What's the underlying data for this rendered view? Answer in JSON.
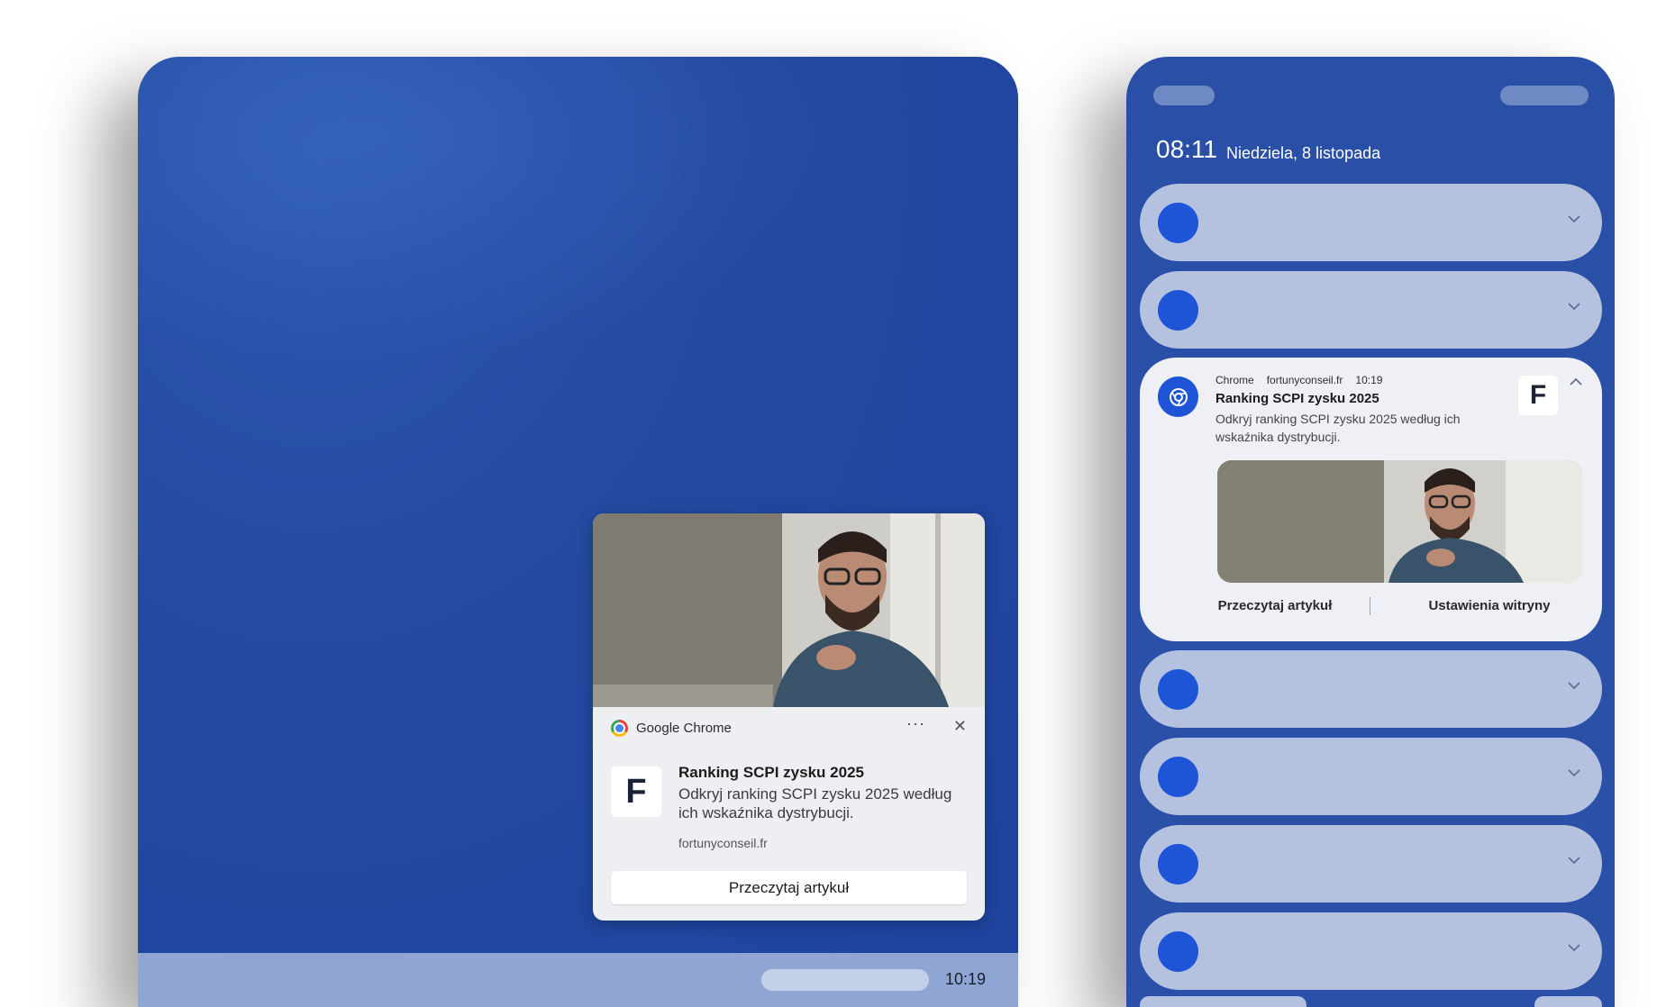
{
  "desktop": {
    "taskbar": {
      "time": "10:19"
    },
    "toast": {
      "app_name": "Google Chrome",
      "more_icon": "more-horizontal-icon",
      "close_icon": "close-icon",
      "logo_letter": "F",
      "title": "Ranking SCPI zysku 2025",
      "body": "Odkryj ranking SCPI zysku 2025 według ich wskaźnika dystrybucji.",
      "site": "fortunyconseil.fr",
      "action_label": "Przeczytaj artykuł"
    }
  },
  "phone": {
    "clock": "08:11",
    "date": "Niedziela, 8 listopada",
    "notification": {
      "app": "Chrome",
      "site": "fortunyconseil.fr",
      "time": "10:19",
      "logo_letter": "F",
      "title": "Ranking SCPI zysku 2025",
      "body": "Odkryj ranking SCPI zysku 2025 według ich wskaźnika dystrybucji.",
      "action_read": "Przeczytaj artykuł",
      "action_settings": "Ustawienia witryny"
    }
  },
  "colors": {
    "wallpaper": "#23499f",
    "notification_dot": "#1d55d6",
    "collapsed_row": "#b4c2e0"
  }
}
